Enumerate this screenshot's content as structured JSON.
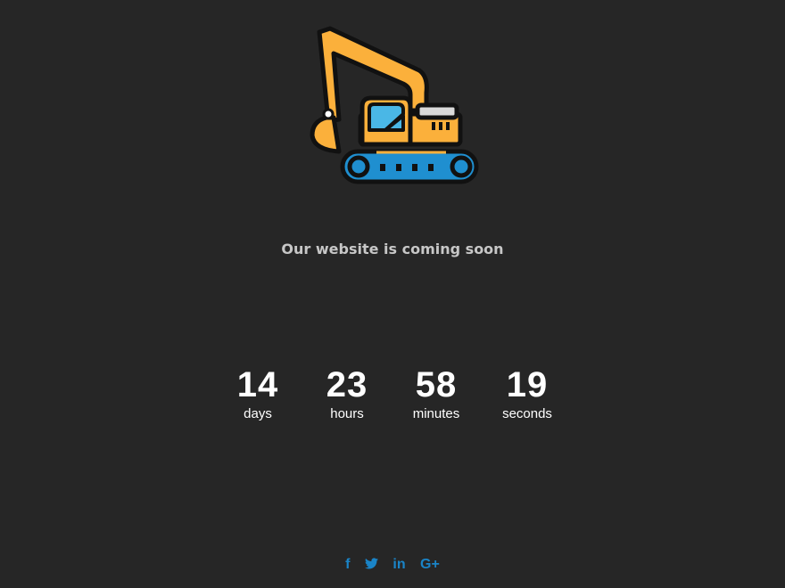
{
  "tagline": "Our website is coming soon",
  "countdown": [
    {
      "value": "14",
      "label": "days"
    },
    {
      "value": "23",
      "label": "hours"
    },
    {
      "value": "58",
      "label": "minutes"
    },
    {
      "value": "19",
      "label": "seconds"
    }
  ],
  "social": [
    {
      "icon": "facebook-icon",
      "glyph": "f"
    },
    {
      "icon": "twitter-icon",
      "glyph": "❧"
    },
    {
      "icon": "linkedin-icon",
      "glyph": "in"
    },
    {
      "icon": "google-plus-icon",
      "glyph": "G+"
    }
  ],
  "colors": {
    "background": "#262626",
    "tagline": "#c7c7c7",
    "countdown": "#ffffff",
    "social": "#1a84c7",
    "excavator_body": "#fbb03b",
    "excavator_glass": "#4ab7e6",
    "excavator_tracks": "#1f8fd0"
  }
}
